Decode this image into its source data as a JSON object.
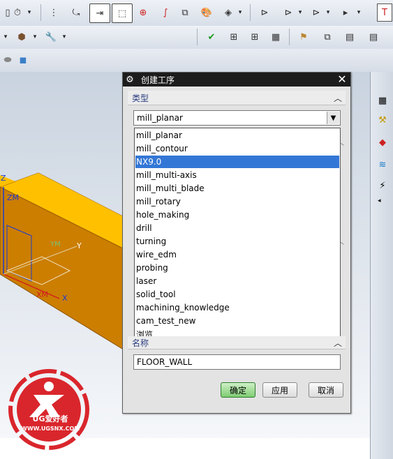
{
  "dialog": {
    "title": "创建工序",
    "type_section": "类型",
    "selected_type": "mill_planar",
    "dropdown_options": [
      "mill_planar",
      "mill_contour",
      "NX9.0",
      "mill_multi-axis",
      "mill_multi_blade",
      "mill_rotary",
      "hole_making",
      "drill",
      "turning",
      "wire_edm",
      "probing",
      "laser",
      "solid_tool",
      "machining_knowledge",
      "cam_test_new",
      "浏览..."
    ],
    "highlighted_option": "NX9.0",
    "name_section": "名称",
    "name_value": "FLOOR_WALL",
    "ok_label": "确定",
    "apply_label": "应用",
    "cancel_label": "取消"
  },
  "viewport": {
    "axis_z": "Z",
    "axis_zm": "ZM",
    "axis_y": "Y",
    "axis_ym": "YM",
    "axis_x": "X",
    "axis_xm": "XM"
  },
  "logo": {
    "brand": "UG爱好者",
    "url": "WWW.UGSNX.COM",
    "color": "#d9262c"
  },
  "colors": {
    "block_top": "#ffc000",
    "block_side": "#cc7e00",
    "highlight": "#3377d6"
  },
  "icons": {
    "toolbar_row1": [
      "display-icon",
      "layer-settings-icon",
      "filter-icon",
      "pattern-icon",
      "section-select-icon",
      "box-select-icon",
      "target-icon",
      "spline-icon",
      "view-fit-icon",
      "palette-icon",
      "shading-icon",
      "operation-move-icon",
      "operation-process-icon",
      "operation-generate-icon",
      "operation-list-icon",
      "window-icon"
    ],
    "toolbar_row2": [
      "assembly-icon",
      "wrench-icon",
      "verify-icon",
      "generate-tool-path-icon",
      "geometry-view-icon",
      "tool-list-icon",
      "flag-icon",
      "layout-icon",
      "document-icon",
      "report-icon"
    ],
    "toolbar_row3": [
      "solid-shape-icon",
      "cube-icon"
    ],
    "right_bar": [
      "create-program-icon",
      "create-tool-icon",
      "create-geometry-icon",
      "create-method-icon",
      "create-operation-icon"
    ]
  }
}
